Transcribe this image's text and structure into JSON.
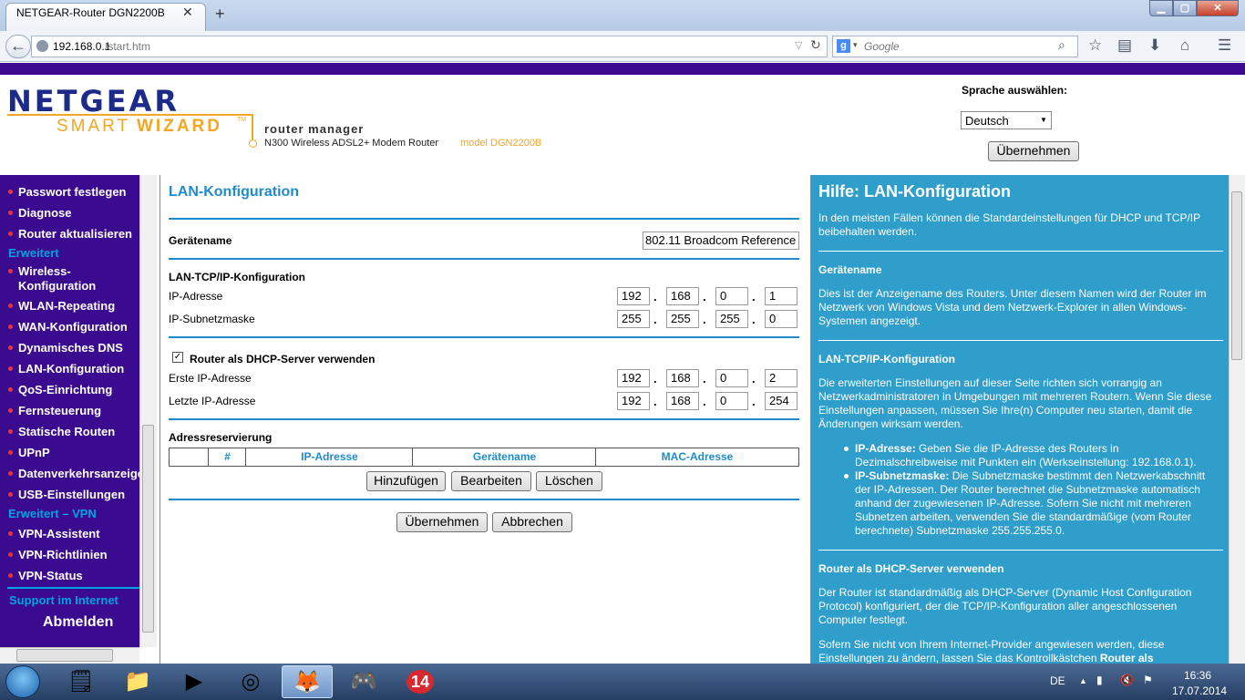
{
  "browser": {
    "tab_title": "NETGEAR-Router DGN2200B",
    "url_host": "192.168.0.1",
    "url_path": "/start.htm",
    "search_placeholder": "Google",
    "search_engine_badge": "g"
  },
  "header": {
    "logo_brand": "NETGEAR",
    "logo_smart": "SMART",
    "logo_wizard": "WIZARD",
    "logo_tm": "TM",
    "router_manager": "router manager",
    "router_desc": "N300 Wireless ADSL2+ Modem Router",
    "router_model": "model DGN2200B",
    "language_label": "Sprache auswählen:",
    "language_value": "Deutsch",
    "language_apply": "Übernehmen"
  },
  "sidebar": {
    "items_top": [
      {
        "label": "Passwort festlegen"
      },
      {
        "label": "Diagnose"
      },
      {
        "label": "Router aktualisieren"
      }
    ],
    "category_advanced": "Erweitert",
    "items_advanced": [
      {
        "label": "Wireless-"
      },
      {
        "label": "Konfiguration"
      },
      {
        "label": "WLAN-Repeating"
      },
      {
        "label": "WAN-Konfiguration"
      },
      {
        "label": "Dynamisches DNS"
      },
      {
        "label": "LAN-Konfiguration"
      },
      {
        "label": "QoS-Einrichtung"
      },
      {
        "label": "Fernsteuerung"
      },
      {
        "label": "Statische Routen"
      },
      {
        "label": "UPnP"
      },
      {
        "label": "Datenverkehrsanzeige"
      },
      {
        "label": "USB-Einstellungen"
      }
    ],
    "category_vpn": "Erweitert – VPN",
    "items_vpn": [
      {
        "label": "VPN-Assistent"
      },
      {
        "label": "VPN-Richtlinien"
      },
      {
        "label": "VPN-Status"
      }
    ],
    "support": "Support im Internet",
    "logout": "Abmelden"
  },
  "main": {
    "title": "LAN-Konfiguration",
    "device_name_label": "Gerätename",
    "device_name_value": "802.11 Broadcom Reference",
    "tcpip_heading": "LAN-TCP/IP-Konfiguration",
    "ip_label": "IP-Adresse",
    "ip": [
      "192",
      "168",
      "0",
      "1"
    ],
    "subnet_label": "IP-Subnetzmaske",
    "subnet": [
      "255",
      "255",
      "255",
      "0"
    ],
    "dhcp_label": "Router als DHCP-Server verwenden",
    "dhcp_checked": true,
    "dhcp_check_glyph": "✓",
    "first_ip_label": "Erste IP-Adresse",
    "first_ip": [
      "192",
      "168",
      "0",
      "2"
    ],
    "last_ip_label": "Letzte IP-Adresse",
    "last_ip": [
      "192",
      "168",
      "0",
      "254"
    ],
    "dot": ".",
    "reservation_heading": "Adressreservierung",
    "table_headers": [
      "",
      "#",
      "IP-Adresse",
      "Gerätename",
      "MAC-Adresse"
    ],
    "btn_add": "Hinzufügen",
    "btn_edit": "Bearbeiten",
    "btn_delete": "Löschen",
    "btn_apply": "Übernehmen",
    "btn_cancel": "Abbrechen"
  },
  "help": {
    "title": "Hilfe: LAN-Konfiguration",
    "intro": "In den meisten Fällen können die Standardeinstellungen für DHCP und TCP/IP beibehalten werden.",
    "device_heading": "Gerätename",
    "device_text": "Dies ist der Anzeigename des Routers. Unter diesem Namen wird der Router im Netzwerk von Windows Vista und dem Netzwerk-Explorer in allen Windows-Systemen angezeigt.",
    "tcpip_heading": "LAN-TCP/IP-Konfiguration",
    "tcpip_text": "Die erweiterten Einstellungen auf dieser Seite richten sich vorrangig an Netzwerkadministratoren in Umgebungen mit mehreren Routern. Wenn Sie diese Einstellungen anpassen, müssen Sie Ihre(n) Computer neu starten, damit die Änderungen wirksam werden.",
    "bullet1_label": "IP-Adresse:",
    "bullet1_text": "Geben Sie die IP-Adresse des Routers in Dezimalschreibweise mit Punkten ein (Werkseinstellung: 192.168.0.1).",
    "bullet2_label": "IP-Subnetzmaske:",
    "bullet2_text": "Die Subnetzmaske bestimmt den Netzwerkabschnitt der IP-Adressen. Der Router berechnet die Subnetzmaske automatisch anhand der zugewiesenen IP-Adresse. Sofern Sie nicht mit mehreren Subnetzen arbeiten, verwenden Sie die standardmäßige (vom Router berechnete) Subnetzmaske 255.255.255.0.",
    "dhcp_heading": "Router als DHCP-Server verwenden",
    "dhcp_text": "Der Router ist standardmäßig als DHCP-Server (Dynamic Host Configuration Protocol) konfiguriert, der die TCP/IP-Konfiguration aller angeschlossenen Computer festlegt.",
    "last_text": "Sofern Sie nicht von Ihrem Internet-Provider angewiesen werden, diese Einstellungen zu ändern, lassen Sie das Kontrollkästchen",
    "last_bold": "Router als"
  },
  "taskbar": {
    "lang": "DE",
    "time": "16:36",
    "date": "17.07.2014",
    "badge": "14"
  },
  "colors": {
    "purple": "#3a0b8e",
    "accent_blue": "#1e8ccb",
    "help_bg": "#2f9ecb",
    "orange": "#f5a623",
    "red_dot": "#ee3333"
  }
}
